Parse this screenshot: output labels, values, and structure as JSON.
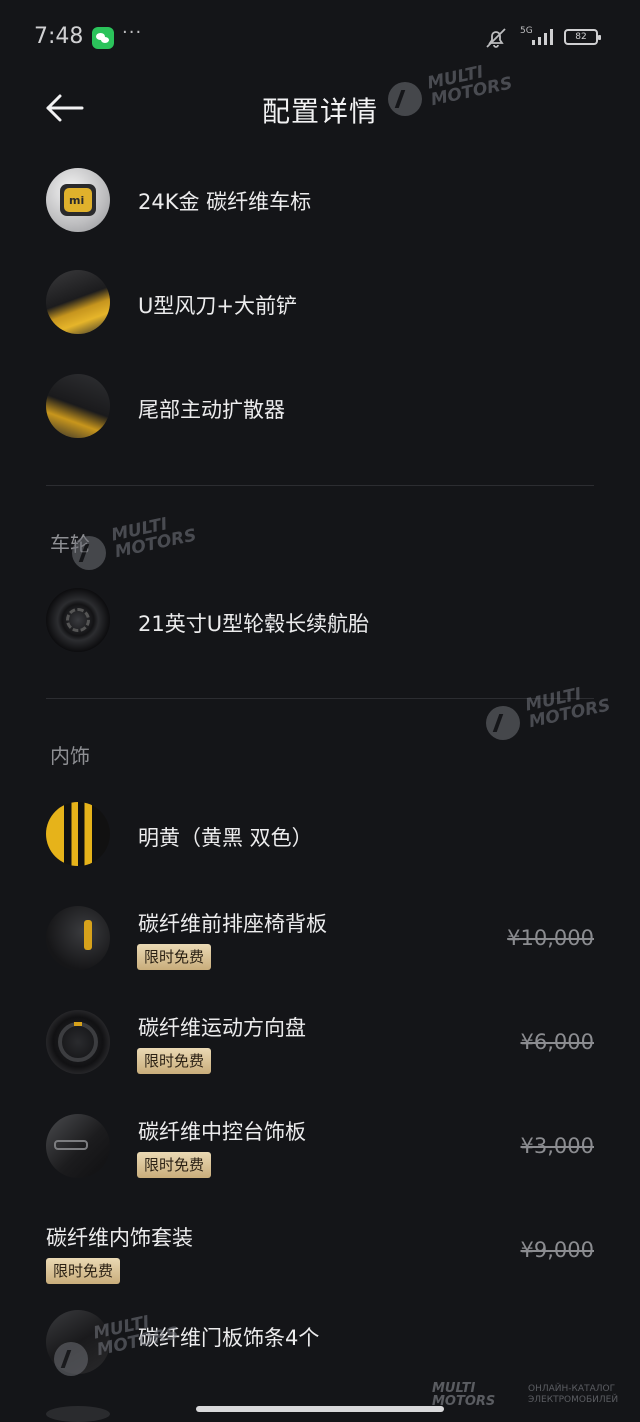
{
  "status_bar": {
    "time": "7:48",
    "more": "···",
    "network": "5G",
    "battery": "82"
  },
  "header": {
    "title": "配置详情"
  },
  "exterior_items": [
    {
      "label": "24K金 碳纤维车标",
      "icon": "gold-badge-icon"
    },
    {
      "label": "U型风刀+大前铲",
      "icon": "front-bumper-thumbnail"
    },
    {
      "label": "尾部主动扩散器",
      "icon": "rear-diffuser-thumbnail"
    }
  ],
  "wheels": {
    "section_title": "车轮",
    "items": [
      {
        "label": "21英寸U型轮毂长续航胎",
        "icon": "wheel-thumbnail"
      }
    ]
  },
  "interior": {
    "section_title": "内饰",
    "items": [
      {
        "label": "明黄（黄黑 双色）",
        "icon": "color-swatch-icon"
      },
      {
        "label": "碳纤维前排座椅背板",
        "badge": "限时免费",
        "price": "¥10,000"
      },
      {
        "label": "碳纤维运动方向盘",
        "badge": "限时免费",
        "price": "¥6,000"
      },
      {
        "label": "碳纤维中控台饰板",
        "badge": "限时免费",
        "price": "¥3,000"
      }
    ]
  },
  "package": {
    "title": "碳纤维内饰套装",
    "badge": "限时免费",
    "price": "¥9,000",
    "items": [
      {
        "label": "碳纤维门板饰条4个"
      }
    ]
  },
  "watermark": {
    "line1": "MULTI",
    "line2": "MOTORS",
    "caption1": "ОНЛАЙН-КАТАЛОГ",
    "caption2": "ЭЛЕКТРОМОБИЛЕЙ"
  },
  "colors": {
    "background": "#141518",
    "badge_gold": "#d7c196",
    "accent_yellow": "#e7b312"
  }
}
